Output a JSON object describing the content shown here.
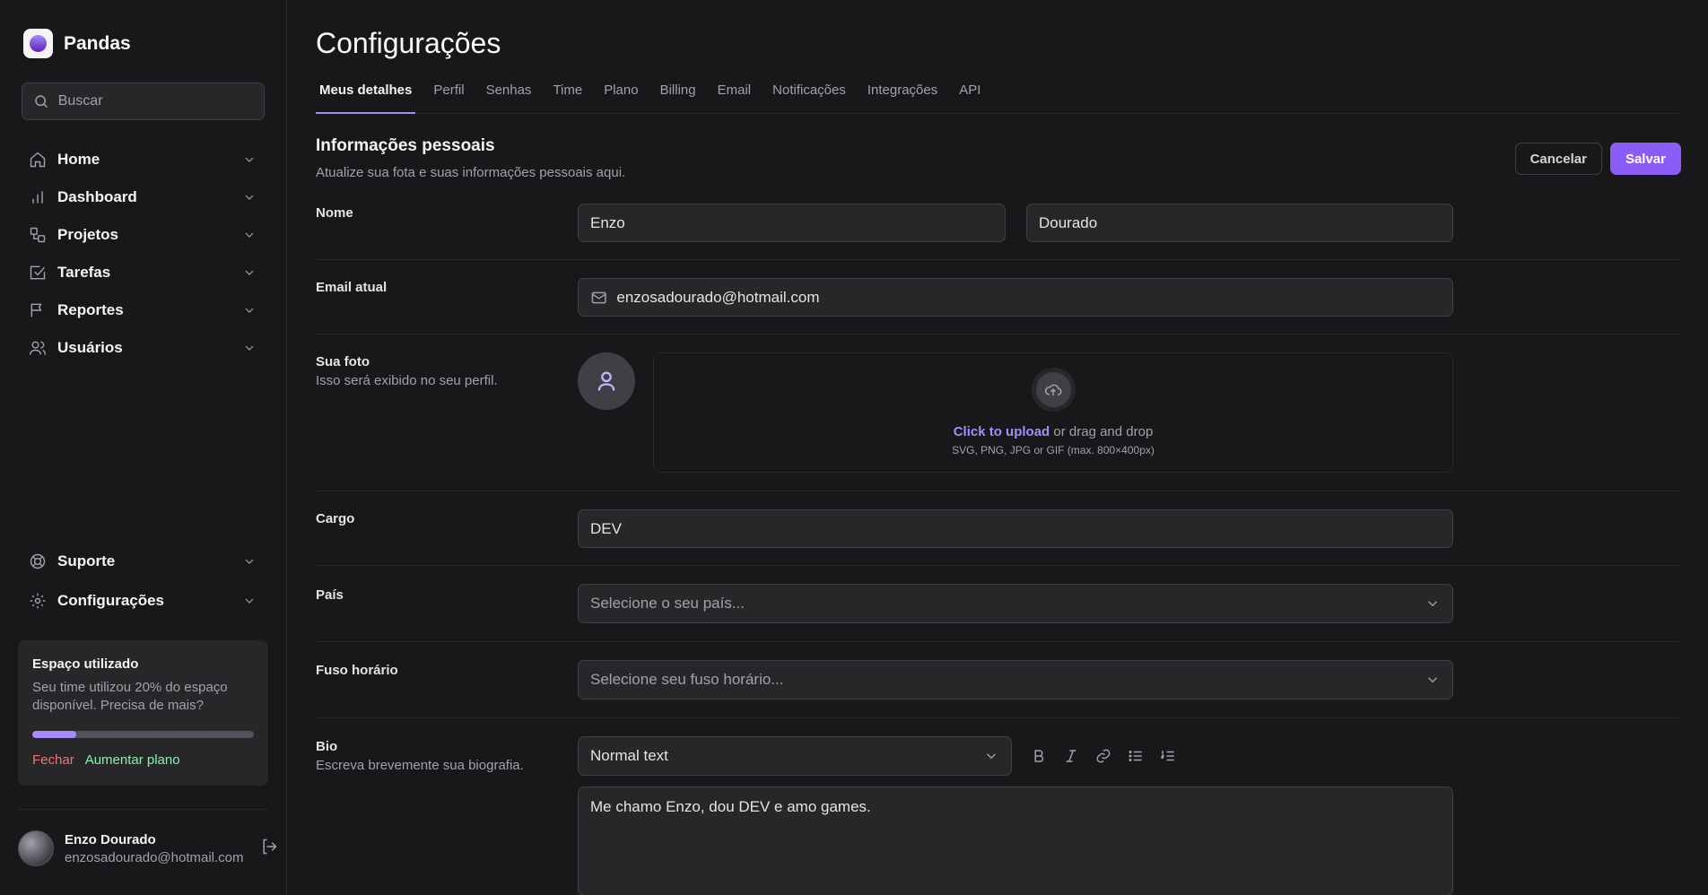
{
  "brand": {
    "name": "Pandas"
  },
  "search": {
    "placeholder": "Buscar"
  },
  "nav": {
    "items": [
      {
        "label": "Home",
        "icon": "home-icon"
      },
      {
        "label": "Dashboard",
        "icon": "bar-chart-icon"
      },
      {
        "label": "Projetos",
        "icon": "layers-icon"
      },
      {
        "label": "Tarefas",
        "icon": "check-square-icon"
      },
      {
        "label": "Reportes",
        "icon": "flag-icon"
      },
      {
        "label": "Usuários",
        "icon": "users-icon"
      }
    ],
    "bottom_items": [
      {
        "label": "Suporte",
        "icon": "life-buoy-icon"
      },
      {
        "label": "Configurações",
        "icon": "gear-icon"
      }
    ]
  },
  "usage": {
    "title": "Espaço utilizado",
    "description": "Seu time utilizou 20% do espaço disponível. Precisa de mais?",
    "percent": 20,
    "close_label": "Fechar",
    "upgrade_label": "Aumentar plano",
    "accent": "#a78bfa"
  },
  "user": {
    "name": "Enzo Dourado",
    "email": "enzosadourado@hotmail.com"
  },
  "page": {
    "title": "Configurações"
  },
  "tabs": [
    {
      "label": "Meus detalhes",
      "active": true
    },
    {
      "label": "Perfil"
    },
    {
      "label": "Senhas"
    },
    {
      "label": "Time"
    },
    {
      "label": "Plano"
    },
    {
      "label": "Billing"
    },
    {
      "label": "Email"
    },
    {
      "label": "Notificações"
    },
    {
      "label": "Integrações"
    },
    {
      "label": "API"
    }
  ],
  "section": {
    "title": "Informações pessoais",
    "subtitle": "Atualize sua fota e suas informações pessoais aqui.",
    "cancel_label": "Cancelar",
    "save_label": "Salvar"
  },
  "form": {
    "name": {
      "label": "Nome",
      "first": "Enzo",
      "last": "Dourado"
    },
    "email": {
      "label": "Email atual",
      "value": "enzosadourado@hotmail.com"
    },
    "photo": {
      "label": "Sua foto",
      "hint": "Isso será exibido no seu perfil.",
      "upload_link": "Click to upload",
      "upload_text": " or drag and drop",
      "upload_hint": "SVG, PNG, JPG or GIF (max. 800×400px)"
    },
    "role": {
      "label": "Cargo",
      "value": "DEV"
    },
    "country": {
      "label": "País",
      "placeholder": "Selecione o seu país..."
    },
    "timezone": {
      "label": "Fuso horário",
      "placeholder": "Selecione seu fuso horário..."
    },
    "bio": {
      "label": "Bio",
      "hint": "Escreva brevemente sua biografia.",
      "format": "Normal text",
      "value": "Me chamo Enzo, dou DEV e amo games."
    }
  },
  "colors": {
    "accent": "#8b5cf6",
    "background": "#18181b",
    "surface": "#27272a"
  }
}
